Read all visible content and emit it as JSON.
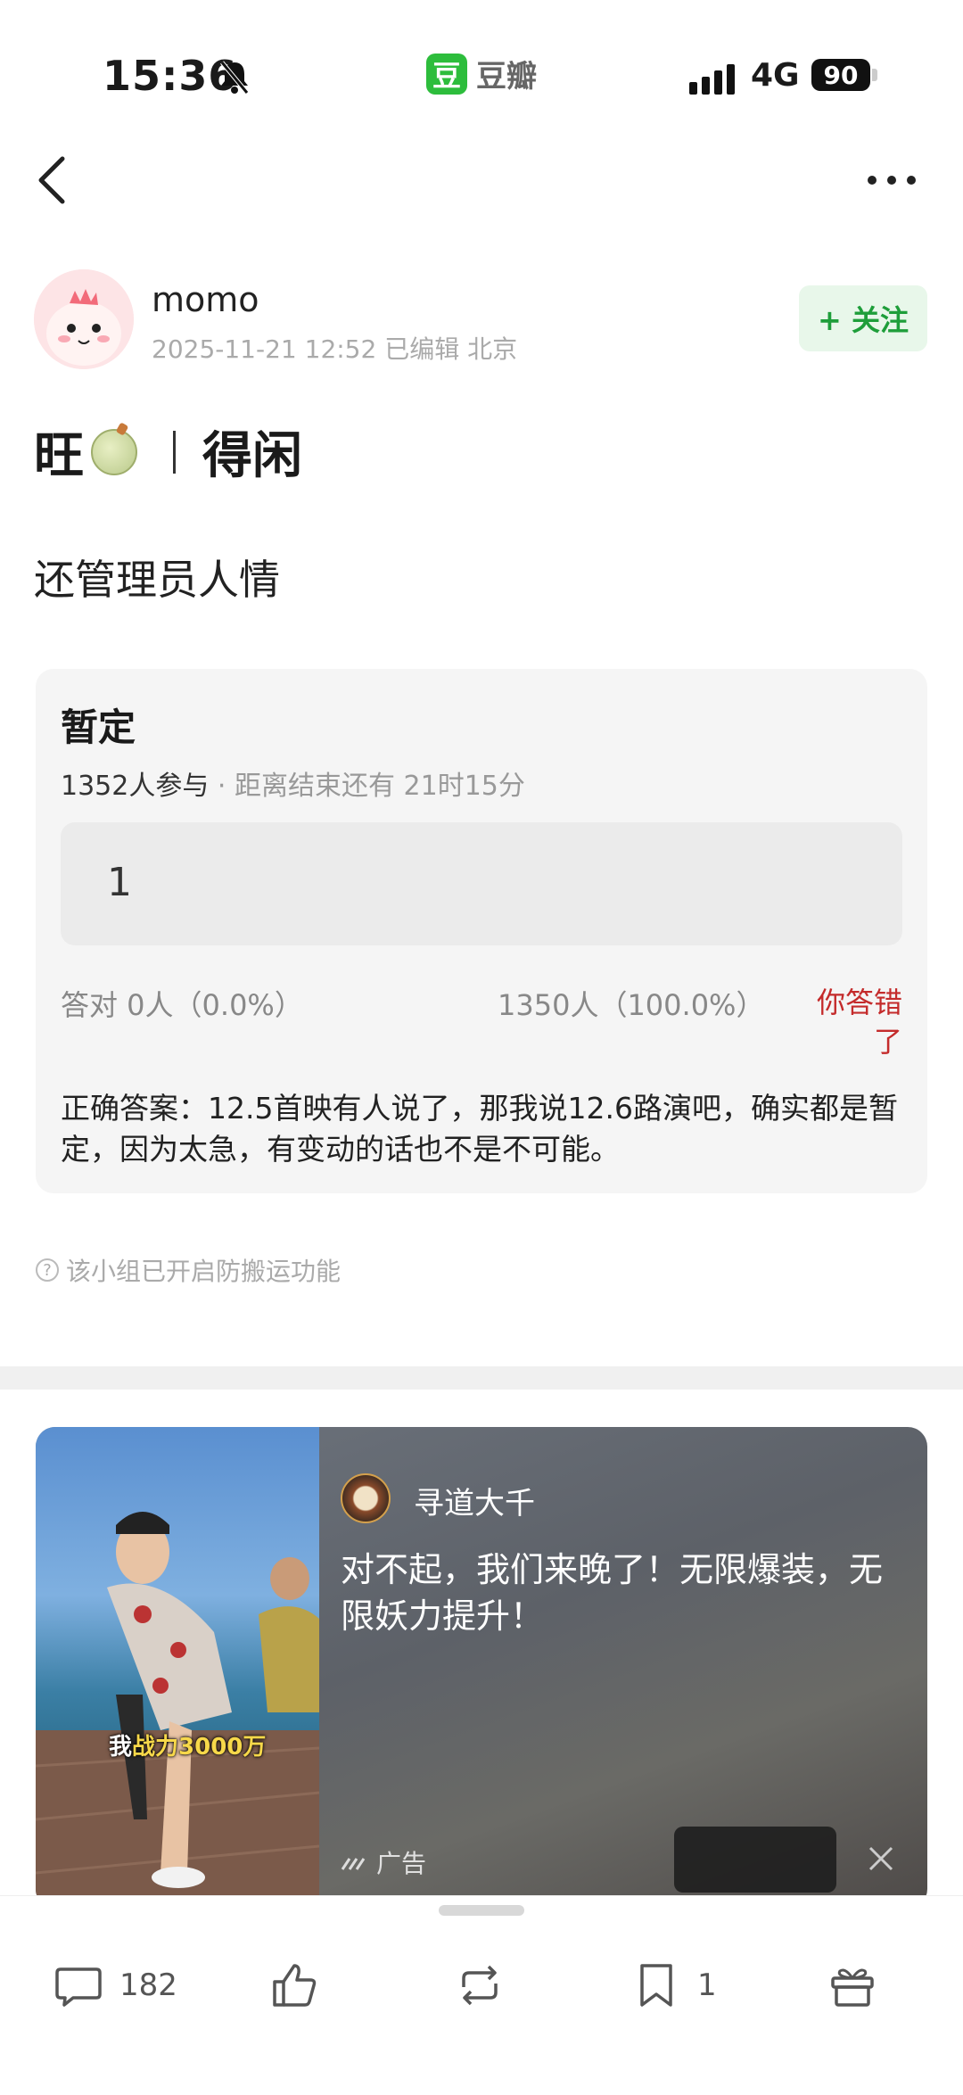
{
  "status_bar": {
    "time": "15:36",
    "app_logo_char": "豆",
    "app_name": "豆瓣",
    "network": "4G",
    "battery": "90"
  },
  "nav": {
    "back_icon": "chevron-left-icon",
    "more_icon": "more-horizontal-icon"
  },
  "author": {
    "name": "momo",
    "meta": "2025-11-21 12:52  已编辑  北京",
    "follow_label": "+ 关注"
  },
  "post": {
    "title_left": "旺",
    "title_right": "得闲",
    "body": "还管理员人情"
  },
  "quiz": {
    "title": "暂定",
    "participants": "1352人参与",
    "remaining": "· 距离结束还有 21时15分",
    "option": "1",
    "correct_stat": "答对  0人（0.0%）",
    "wrong_stat": "1350人（100.0%）",
    "wrong_label": "你答错了",
    "answer": "正确答案：12.5首映有人说了，那我说12.6路演吧，确实都是暂定，因为太急，有变动的话也不是不可能。"
  },
  "anti_copy": "该小组已开启防搬运功能",
  "ad": {
    "caption_a": "我",
    "caption_b": "战力3000万",
    "author": "寻道大千",
    "text": "对不起，我们来晚了！无限爆装，无限妖力提升！",
    "label": "广告"
  },
  "bottom_bar": {
    "comment_count": "182",
    "bookmark_count": "1"
  },
  "colors": {
    "accent_green": "#1e9e3a",
    "follow_bg": "#e8f7ea",
    "error_red": "#c42b2b"
  }
}
